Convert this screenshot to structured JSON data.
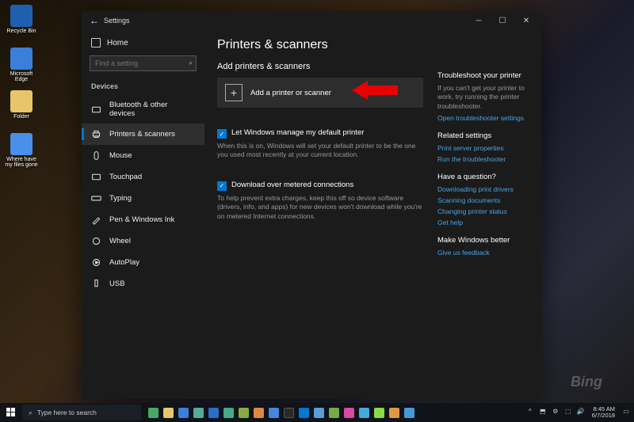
{
  "desktop": {
    "icons": [
      {
        "label": "Recycle Bin"
      },
      {
        "label": "Microsoft Edge"
      },
      {
        "label": "Folder"
      },
      {
        "label": "Where have my files gone"
      }
    ],
    "watermark": "Bing"
  },
  "window": {
    "title": "Settings",
    "back_icon": "←"
  },
  "sidebar": {
    "home": "Home",
    "search_placeholder": "Find a setting",
    "category": "Devices",
    "items": [
      {
        "label": "Bluetooth & other devices"
      },
      {
        "label": "Printers & scanners"
      },
      {
        "label": "Mouse"
      },
      {
        "label": "Touchpad"
      },
      {
        "label": "Typing"
      },
      {
        "label": "Pen & Windows Ink"
      },
      {
        "label": "Wheel"
      },
      {
        "label": "AutoPlay"
      },
      {
        "label": "USB"
      }
    ]
  },
  "content": {
    "heading": "Printers & scanners",
    "add_heading": "Add printers & scanners",
    "add_button": "Add a printer or scanner",
    "chk1_label": "Let Windows manage my default printer",
    "chk1_desc": "When this is on, Windows will set your default printer to be the one you used most recently at your current location.",
    "chk2_label": "Download over metered connections",
    "chk2_desc": "To help prevent extra charges, keep this off so device software (drivers, info, and apps) for new devices won't download while you're on metered Internet connections."
  },
  "right": {
    "troubleshoot_h": "Troubleshoot your printer",
    "troubleshoot_txt": "If you can't get your printer to work, try running the printer troubleshooter.",
    "troubleshoot_link": "Open troubleshooter settings",
    "related_h": "Related settings",
    "related_links": [
      "Print server properties",
      "Run the troubleshooter"
    ],
    "question_h": "Have a question?",
    "question_links": [
      "Downloading print drivers",
      "Scanning documents",
      "Changing printer status",
      "Get help"
    ],
    "better_h": "Make Windows better",
    "better_link": "Give us feedback"
  },
  "taskbar": {
    "search_placeholder": "Type here to search",
    "clock_time": "8:45 AM",
    "clock_date": "6/7/2018"
  }
}
